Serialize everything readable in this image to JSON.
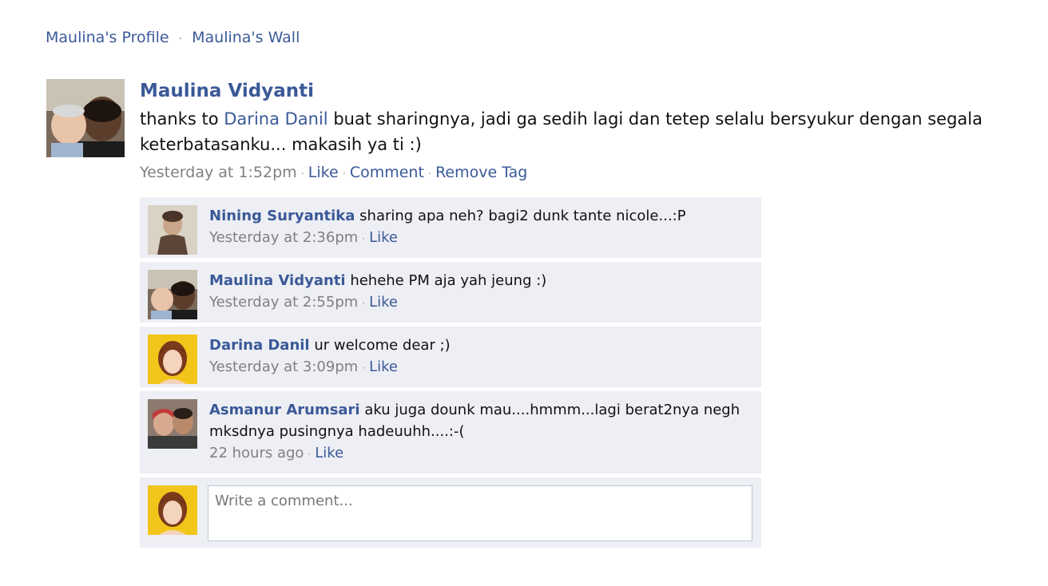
{
  "breadcrumb": {
    "profile_label": "Maulina's Profile",
    "separator": "·",
    "wall_label": "Maulina's Wall"
  },
  "post": {
    "author": "Maulina Vidyanti",
    "text_before": "thanks to ",
    "mention": "Darina Danil",
    "text_after": " buat sharingnya, jadi ga sedih lagi dan tetep selalu bersyukur dengan segala keterbatasanku... makasih ya ti :)",
    "timestamp": "Yesterday at 1:52pm",
    "actions": [
      "Like",
      "Comment",
      "Remove Tag"
    ]
  },
  "comments": [
    {
      "author": "Nining Suryantika",
      "text": "sharing apa neh? bagi2 dunk tante nicole...:P",
      "timestamp": "Yesterday at 2:36pm",
      "like": "Like"
    },
    {
      "author": "Maulina Vidyanti",
      "text": "hehehe PM aja yah jeung :)",
      "timestamp": "Yesterday at 2:55pm",
      "like": "Like"
    },
    {
      "author": "Darina Danil",
      "text": "ur welcome dear ;)",
      "timestamp": "Yesterday at 3:09pm",
      "like": "Like"
    },
    {
      "author": "Asmanur Arumsari",
      "text": "aku juga dounk mau....hmmm...lagi berat2nya negh mksdnya pusingnya hadeuuhh....:-(",
      "timestamp": "22 hours ago",
      "like": "Like"
    }
  ],
  "composer": {
    "placeholder": "Write a comment..."
  },
  "colors": {
    "link": "#3b5998",
    "comment_bg": "#edeff4",
    "meta": "#808080"
  }
}
